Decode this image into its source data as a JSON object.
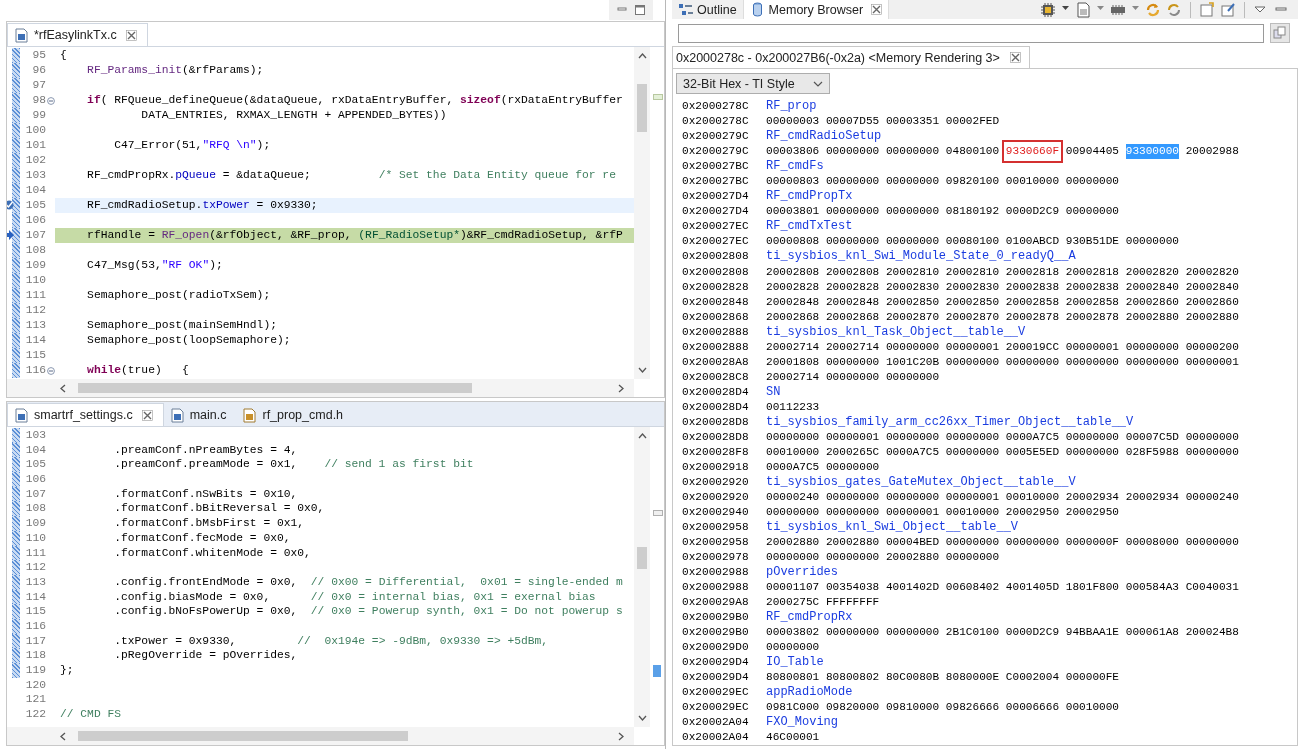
{
  "editors": [
    {
      "tabs": [
        {
          "label": "*rfEasylinkTx.c",
          "kind": "source",
          "selected": true
        }
      ],
      "lines": [
        {
          "number": "95",
          "changed": true,
          "fold": false,
          "current": false,
          "execution_point": false,
          "breakpoint": false,
          "code": [
            "{"
          ]
        },
        {
          "number": "96",
          "changed": true,
          "fold": false,
          "current": false,
          "execution_point": false,
          "breakpoint": false,
          "code": [
            {
              "kind": "macro",
              "text": "    RF_Params_init"
            },
            "(&rfParams);"
          ]
        },
        {
          "number": "97",
          "changed": true,
          "fold": false,
          "current": false,
          "execution_point": false,
          "breakpoint": false
        },
        {
          "number": "98",
          "changed": true,
          "fold": true,
          "current": false,
          "execution_point": false,
          "breakpoint": false,
          "code": [
            {
              "kind": "keyword",
              "text": "    if"
            },
            "( RFQueue_defineQueue(&dataQueue, rxDataEntryBuffer, ",
            {
              "kind": "keyword",
              "text": "sizeof"
            },
            "(rxDataEntryBuffer"
          ]
        },
        {
          "number": "99",
          "changed": true,
          "fold": false,
          "current": false,
          "execution_point": false,
          "breakpoint": false,
          "code": [
            "            DATA_ENTRIES, RXMAX_LENGTH + APPENDED_BYTES))"
          ]
        },
        {
          "number": "100",
          "changed": true,
          "fold": false,
          "current": false,
          "execution_point": false,
          "breakpoint": false
        },
        {
          "number": "101",
          "changed": true,
          "fold": false,
          "current": false,
          "execution_point": false,
          "breakpoint": false,
          "code": [
            "        C47_Error(51,",
            {
              "kind": "string",
              "text": "\"RFQ \\n\""
            },
            ");"
          ]
        },
        {
          "number": "102",
          "changed": true,
          "fold": false,
          "current": false,
          "execution_point": false,
          "breakpoint": false
        },
        {
          "number": "103",
          "changed": true,
          "fold": false,
          "current": false,
          "execution_point": false,
          "breakpoint": false,
          "code": [
            "    RF_cmdPropRx.",
            {
              "kind": "field",
              "text": "pQueue"
            },
            " = &dataQueue;          ",
            {
              "kind": "comment",
              "text": "/* Set the Data Entity queue for re"
            }
          ]
        },
        {
          "number": "104",
          "changed": true,
          "fold": false,
          "current": false,
          "execution_point": false,
          "breakpoint": false
        },
        {
          "number": "105",
          "changed": true,
          "fold": false,
          "current": true,
          "execution_point": false,
          "breakpoint": true,
          "code": [
            "    RF_cmdRadioSetup.",
            {
              "kind": "field",
              "text": "txPower"
            },
            " = 0x9330;"
          ]
        },
        {
          "number": "106",
          "changed": true,
          "fold": false,
          "current": false,
          "execution_point": false,
          "breakpoint": false
        },
        {
          "number": "107",
          "changed": true,
          "fold": false,
          "current": false,
          "execution_point": true,
          "breakpoint": false,
          "code": [
            "    rfHandle = ",
            {
              "kind": "macro",
              "text": "RF_open"
            },
            "(&rfObject, &RF_prop, ",
            {
              "kind": "type",
              "text": "(RF_RadioSetup*"
            },
            ")&RF_cmdRadioSetup, &rfP"
          ]
        },
        {
          "number": "108",
          "changed": true,
          "fold": false,
          "current": false,
          "execution_point": false,
          "breakpoint": false
        },
        {
          "number": "109",
          "changed": true,
          "fold": false,
          "current": false,
          "execution_point": false,
          "breakpoint": false,
          "code": [
            "    C47_Msg(53,",
            {
              "kind": "string",
              "text": "\"RF OK\""
            },
            ");"
          ]
        },
        {
          "number": "110",
          "changed": true,
          "fold": false,
          "current": false,
          "execution_point": false,
          "breakpoint": false
        },
        {
          "number": "111",
          "changed": true,
          "fold": false,
          "current": false,
          "execution_point": false,
          "breakpoint": false,
          "code": [
            "    Semaphore_post(radioTxSem);"
          ]
        },
        {
          "number": "112",
          "changed": true,
          "fold": false,
          "current": false,
          "execution_point": false,
          "breakpoint": false
        },
        {
          "number": "113",
          "changed": true,
          "fold": false,
          "current": false,
          "execution_point": false,
          "breakpoint": false,
          "code": [
            "    Semaphore_post(mainSemHndl);"
          ]
        },
        {
          "number": "114",
          "changed": true,
          "fold": false,
          "current": false,
          "execution_point": false,
          "breakpoint": false,
          "code": [
            "    Semaphore_post(loopSemaphore);"
          ]
        },
        {
          "number": "115",
          "changed": true,
          "fold": false,
          "current": false,
          "execution_point": false,
          "breakpoint": false
        },
        {
          "number": "116",
          "changed": true,
          "fold": true,
          "current": false,
          "execution_point": false,
          "breakpoint": false,
          "code": [
            {
              "kind": "keyword",
              "text": "    while"
            },
            "(true)   {"
          ]
        }
      ]
    },
    {
      "tabs": [
        {
          "label": "smartrf_settings.c",
          "kind": "source",
          "selected": true
        },
        {
          "label": "main.c",
          "kind": "source",
          "selected": false
        },
        {
          "label": "rf_prop_cmd.h",
          "kind": "header",
          "selected": false
        }
      ],
      "lines": [
        {
          "number": "103",
          "changed": true,
          "fold": false,
          "current": false,
          "execution_point": false,
          "breakpoint": false
        },
        {
          "number": "104",
          "changed": true,
          "fold": false,
          "current": false,
          "execution_point": false,
          "breakpoint": false,
          "code": [
            "        .preamConf.nPreamBytes = 4,"
          ]
        },
        {
          "number": "105",
          "changed": true,
          "fold": false,
          "current": false,
          "execution_point": false,
          "breakpoint": false,
          "code": [
            "        .preamConf.preamMode = 0x1,    ",
            {
              "kind": "comment",
              "text": "// send 1 as first bit"
            }
          ]
        },
        {
          "number": "106",
          "changed": true,
          "fold": false,
          "current": false,
          "execution_point": false,
          "breakpoint": false
        },
        {
          "number": "107",
          "changed": true,
          "fold": false,
          "current": false,
          "execution_point": false,
          "breakpoint": false,
          "code": [
            "        .formatConf.nSwBits = 0x10,"
          ]
        },
        {
          "number": "108",
          "changed": true,
          "fold": false,
          "current": false,
          "execution_point": false,
          "breakpoint": false,
          "code": [
            "        .formatConf.bBitReversal = 0x0,"
          ]
        },
        {
          "number": "109",
          "changed": true,
          "fold": false,
          "current": false,
          "execution_point": false,
          "breakpoint": false,
          "code": [
            "        .formatConf.bMsbFirst = 0x1,"
          ]
        },
        {
          "number": "110",
          "changed": true,
          "fold": false,
          "current": false,
          "execution_point": false,
          "breakpoint": false,
          "code": [
            "        .formatConf.fecMode = 0x0,"
          ]
        },
        {
          "number": "111",
          "changed": true,
          "fold": false,
          "current": false,
          "execution_point": false,
          "breakpoint": false,
          "code": [
            "        .formatConf.whitenMode = 0x0,"
          ]
        },
        {
          "number": "112",
          "changed": true,
          "fold": false,
          "current": false,
          "execution_point": false,
          "breakpoint": false
        },
        {
          "number": "113",
          "changed": true,
          "fold": false,
          "current": false,
          "execution_point": false,
          "breakpoint": false,
          "code": [
            "        .config.frontEndMode = 0x0,  ",
            {
              "kind": "comment",
              "text": "// 0x00 = Differential,  0x01 = single-ended m"
            }
          ]
        },
        {
          "number": "114",
          "changed": true,
          "fold": false,
          "current": false,
          "execution_point": false,
          "breakpoint": false,
          "code": [
            "        .config.biasMode = 0x0,      ",
            {
              "kind": "comment",
              "text": "// 0x0 = internal bias, 0x1 = exernal bias"
            }
          ]
        },
        {
          "number": "115",
          "changed": true,
          "fold": false,
          "current": false,
          "execution_point": false,
          "breakpoint": false,
          "code": [
            "        .config.bNoFsPowerUp = 0x0,  ",
            {
              "kind": "comment",
              "text": "// 0x0 = Powerup synth, 0x1 = Do not powerup s"
            }
          ]
        },
        {
          "number": "116",
          "changed": true,
          "fold": false,
          "current": false,
          "execution_point": false,
          "breakpoint": false
        },
        {
          "number": "117",
          "changed": true,
          "fold": false,
          "current": false,
          "execution_point": false,
          "breakpoint": false,
          "code": [
            "        .txPower = 0x9330,         ",
            {
              "kind": "comment",
              "text": "//  0x194e => -9dBm, 0x9330 => +5dBm,"
            }
          ]
        },
        {
          "number": "118",
          "changed": true,
          "fold": false,
          "current": false,
          "execution_point": false,
          "breakpoint": false,
          "code": [
            "        .pRegOverride = pOverrides,"
          ]
        },
        {
          "number": "119",
          "changed": true,
          "fold": false,
          "current": false,
          "execution_point": false,
          "breakpoint": false,
          "code": [
            "};"
          ]
        },
        {
          "number": "120",
          "changed": false,
          "fold": false,
          "current": false,
          "execution_point": false,
          "breakpoint": false
        },
        {
          "number": "121",
          "changed": false,
          "fold": false,
          "current": false,
          "execution_point": false,
          "breakpoint": false
        },
        {
          "number": "122",
          "changed": false,
          "fold": false,
          "current": false,
          "execution_point": false,
          "breakpoint": false,
          "code": [
            {
              "kind": "comment",
              "text": "// CMD FS"
            }
          ]
        }
      ]
    }
  ],
  "view_tabs": [
    {
      "label": "Outline",
      "kind": "outline",
      "selected": false
    },
    {
      "label": "Memory Browser",
      "kind": "memory",
      "selected": true
    }
  ],
  "memory_browser": {
    "rendering_tab": {
      "label": "0x2000278c - 0x200027B6(-0x2a) <Memory Rendering 3>",
      "selected": true
    },
    "format": "32-Bit Hex - TI Style",
    "rows": [
      {
        "kind": "label",
        "address": "0x2000278C",
        "label": "RF_prop"
      },
      {
        "kind": "data",
        "address": "0x2000278C",
        "words": [
          "00000003",
          "00007D55",
          "00003351",
          "00002FED"
        ]
      },
      {
        "kind": "label",
        "address": "0x2000279C",
        "label": "RF_cmdRadioSetup"
      },
      {
        "kind": "data",
        "address": "0x2000279C",
        "words": [
          "00003806",
          "00000000",
          "00000000",
          "04800100",
          {
            "text": "9330660F",
            "outlined": true,
            "selected": false
          },
          "00904405",
          {
            "text": "93300000",
            "outlined": false,
            "selected": true
          },
          "20002988"
        ]
      },
      {
        "kind": "label",
        "address": "0x200027BC",
        "label": "RF_cmdFs"
      },
      {
        "kind": "data",
        "address": "0x200027BC",
        "words": [
          "00000803",
          "00000000",
          "00000000",
          "09820100",
          "00010000",
          "00000000"
        ]
      },
      {
        "kind": "label",
        "address": "0x200027D4",
        "label": "RF_cmdPropTx"
      },
      {
        "kind": "data",
        "address": "0x200027D4",
        "words": [
          "00003801",
          "00000000",
          "00000000",
          "08180192",
          "0000D2C9",
          "00000000"
        ]
      },
      {
        "kind": "label",
        "address": "0x200027EC",
        "label": "RF_cmdTxTest"
      },
      {
        "kind": "data",
        "address": "0x200027EC",
        "words": [
          "00000808",
          "00000000",
          "00000000",
          "00080100",
          "0100ABCD",
          "930B51DE",
          "00000000"
        ]
      },
      {
        "kind": "label",
        "address": "0x20002808",
        "label": "ti_sysbios_knl_Swi_Module_State_0_readyQ__A"
      },
      {
        "kind": "data",
        "address": "0x20002808",
        "words": [
          "20002808",
          "20002808",
          "20002810",
          "20002810",
          "20002818",
          "20002818",
          "20002820",
          "20002820"
        ]
      },
      {
        "kind": "data",
        "address": "0x20002828",
        "words": [
          "20002828",
          "20002828",
          "20002830",
          "20002830",
          "20002838",
          "20002838",
          "20002840",
          "20002840"
        ]
      },
      {
        "kind": "data",
        "address": "0x20002848",
        "words": [
          "20002848",
          "20002848",
          "20002850",
          "20002850",
          "20002858",
          "20002858",
          "20002860",
          "20002860"
        ]
      },
      {
        "kind": "data",
        "address": "0x20002868",
        "words": [
          "20002868",
          "20002868",
          "20002870",
          "20002870",
          "20002878",
          "20002878",
          "20002880",
          "20002880"
        ]
      },
      {
        "kind": "label",
        "address": "0x20002888",
        "label": "ti_sysbios_knl_Task_Object__table__V"
      },
      {
        "kind": "data",
        "address": "0x20002888",
        "words": [
          "20002714",
          "20002714",
          "00000000",
          "00000001",
          "200019CC",
          "00000001",
          "00000000",
          "00000200"
        ]
      },
      {
        "kind": "data",
        "address": "0x200028A8",
        "words": [
          "20001808",
          "00000000",
          "1001C20B",
          "00000000",
          "00000000",
          "00000000",
          "00000000",
          "00000001"
        ]
      },
      {
        "kind": "data",
        "address": "0x200028C8",
        "words": [
          "20002714",
          "00000000",
          "00000000"
        ]
      },
      {
        "kind": "label",
        "address": "0x200028D4",
        "label": "SN"
      },
      {
        "kind": "data",
        "address": "0x200028D4",
        "words": [
          "00112233"
        ]
      },
      {
        "kind": "label",
        "address": "0x200028D8",
        "label": "ti_sysbios_family_arm_cc26xx_Timer_Object__table__V"
      },
      {
        "kind": "data",
        "address": "0x200028D8",
        "words": [
          "00000000",
          "00000001",
          "00000000",
          "00000000",
          "0000A7C5",
          "00000000",
          "00007C5D",
          "00000000"
        ]
      },
      {
        "kind": "data",
        "address": "0x200028F8",
        "words": [
          "00010000",
          "2000265C",
          "0000A7C5",
          "00000000",
          "0005E5ED",
          "00000000",
          "028F5988",
          "00000000"
        ]
      },
      {
        "kind": "data",
        "address": "0x20002918",
        "words": [
          "0000A7C5",
          "00000000"
        ]
      },
      {
        "kind": "label",
        "address": "0x20002920",
        "label": "ti_sysbios_gates_GateMutex_Object__table__V"
      },
      {
        "kind": "data",
        "address": "0x20002920",
        "words": [
          "00000240",
          "00000000",
          "00000000",
          "00000001",
          "00010000",
          "20002934",
          "20002934",
          "00000240"
        ]
      },
      {
        "kind": "data",
        "address": "0x20002940",
        "words": [
          "00000000",
          "00000000",
          "00000001",
          "00010000",
          "20002950",
          "20002950"
        ]
      },
      {
        "kind": "label",
        "address": "0x20002958",
        "label": "ti_sysbios_knl_Swi_Object__table__V"
      },
      {
        "kind": "data",
        "address": "0x20002958",
        "words": [
          "20002880",
          "20002880",
          "00004BED",
          "00000000",
          "00000000",
          "0000000F",
          "00008000",
          "00000000"
        ]
      },
      {
        "kind": "data",
        "address": "0x20002978",
        "words": [
          "00000000",
          "00000000",
          "20002880",
          "00000000"
        ]
      },
      {
        "kind": "label",
        "address": "0x20002988",
        "label": "pOverrides"
      },
      {
        "kind": "data",
        "address": "0x20002988",
        "words": [
          "00001107",
          "00354038",
          "4001402D",
          "00608402",
          "4001405D",
          "1801F800",
          "000584A3",
          "C0040031"
        ]
      },
      {
        "kind": "data",
        "address": "0x200029A8",
        "words": [
          "2000275C",
          "FFFFFFFF"
        ]
      },
      {
        "kind": "label",
        "address": "0x200029B0",
        "label": "RF_cmdPropRx"
      },
      {
        "kind": "data",
        "address": "0x200029B0",
        "words": [
          "00003802",
          "00000000",
          "00000000",
          "2B1C0100",
          "0000D2C9",
          "94BBAA1E",
          "000061A8",
          "200024B8"
        ]
      },
      {
        "kind": "data",
        "address": "0x200029D0",
        "words": [
          "00000000"
        ]
      },
      {
        "kind": "label",
        "address": "0x200029D4",
        "label": "IO_Table"
      },
      {
        "kind": "data",
        "address": "0x200029D4",
        "words": [
          "80800801",
          "80800802",
          "80C0080B",
          "8080000E",
          "C0002004",
          "000000FE"
        ]
      },
      {
        "kind": "label",
        "address": "0x200029EC",
        "label": "appRadioMode"
      },
      {
        "kind": "data",
        "address": "0x200029EC",
        "words": [
          "0981C000",
          "09820000",
          "09810000",
          "09826666",
          "00006666",
          "00010000"
        ]
      },
      {
        "kind": "label",
        "address": "0x20002A04",
        "label": "FXO_Moving"
      },
      {
        "kind": "data",
        "address": "0x20002A04",
        "words": [
          "46C00001"
        ]
      }
    ]
  }
}
